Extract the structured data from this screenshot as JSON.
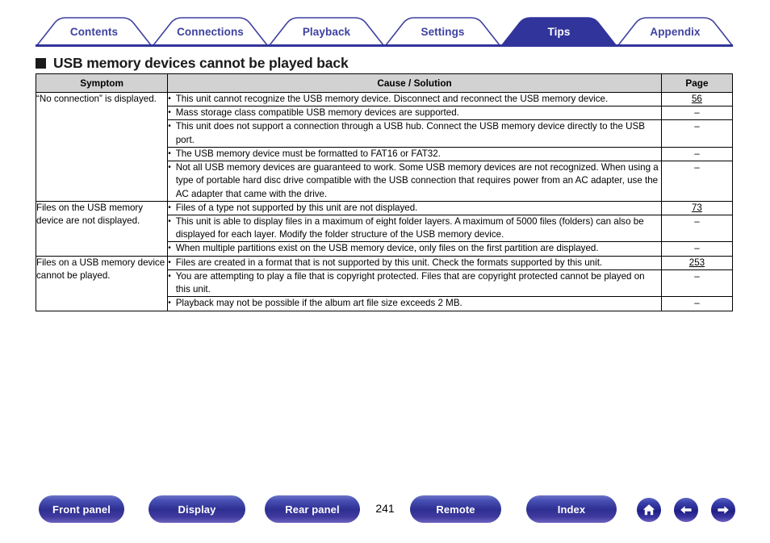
{
  "tabs": [
    {
      "label": "Contents",
      "active": false
    },
    {
      "label": "Connections",
      "active": false
    },
    {
      "label": "Playback",
      "active": false
    },
    {
      "label": "Settings",
      "active": false
    },
    {
      "label": "Tips",
      "active": true
    },
    {
      "label": "Appendix",
      "active": false
    }
  ],
  "heading": {
    "text": "USB memory devices cannot be played back"
  },
  "table": {
    "headers": {
      "symptom": "Symptom",
      "cause": "Cause / Solution",
      "page": "Page"
    },
    "groups": [
      {
        "symptom": "“No connection” is displayed.",
        "rows": [
          {
            "cause": "This unit cannot recognize the USB memory device. Disconnect and reconnect the USB memory device.",
            "page": "56",
            "page_is_link": true
          },
          {
            "cause": "Mass storage class compatible USB memory devices are supported.",
            "page": "–",
            "page_is_link": false
          },
          {
            "cause": "This unit does not support a connection through a USB hub. Connect the USB memory device directly to the USB port.",
            "page": "–",
            "page_is_link": false
          },
          {
            "cause": "The USB memory device must be formatted to FAT16 or FAT32.",
            "page": "–",
            "page_is_link": false
          },
          {
            "cause": "Not all USB memory devices are guaranteed to work. Some USB memory devices are not recognized. When using a type of portable hard disc drive compatible with the USB connection that requires power from an AC adapter, use the AC adapter that came with the drive.",
            "page": "–",
            "page_is_link": false
          }
        ]
      },
      {
        "symptom": "Files on the USB memory device are not displayed.",
        "rows": [
          {
            "cause": "Files of a type not supported by this unit are not displayed.",
            "page": "73",
            "page_is_link": true
          },
          {
            "cause": "This unit is able to display files in a maximum of eight folder layers. A maximum of 5000 files (folders) can also be displayed for each layer. Modify the folder structure of the USB memory device.",
            "page": "–",
            "page_is_link": false
          },
          {
            "cause": "When multiple partitions exist on the USB memory device, only files on the first partition are displayed.",
            "page": "–",
            "page_is_link": false
          }
        ]
      },
      {
        "symptom": "Files on a USB memory device cannot be played.",
        "rows": [
          {
            "cause": "Files are created in a format that is not supported by this unit. Check the formats supported by this unit.",
            "page": "253",
            "page_is_link": true
          },
          {
            "cause": "You are attempting to play a file that is copyright protected. Files that are copyright protected cannot be played on this unit.",
            "page": "–",
            "page_is_link": false
          },
          {
            "cause": "Playback may not be possible if the album art file size exceeds 2 MB.",
            "page": "–",
            "page_is_link": false
          }
        ]
      }
    ]
  },
  "footer": {
    "buttons": [
      {
        "id": "front",
        "label": "Front panel"
      },
      {
        "id": "disp",
        "label": "Display"
      },
      {
        "id": "rear",
        "label": "Rear panel"
      },
      {
        "id": "remote",
        "label": "Remote"
      },
      {
        "id": "index",
        "label": "Index"
      }
    ],
    "page_number": "241",
    "icons": [
      {
        "id": "home",
        "name": "home-icon"
      },
      {
        "id": "back",
        "name": "arrow-left-icon"
      },
      {
        "id": "fwd",
        "name": "arrow-right-icon"
      }
    ]
  },
  "colors": {
    "tab_blue": "#3f41a0",
    "tab_active_fill": "#31349a",
    "header_gray": "#d2d2d2",
    "button_blue": "#2f2f92"
  }
}
